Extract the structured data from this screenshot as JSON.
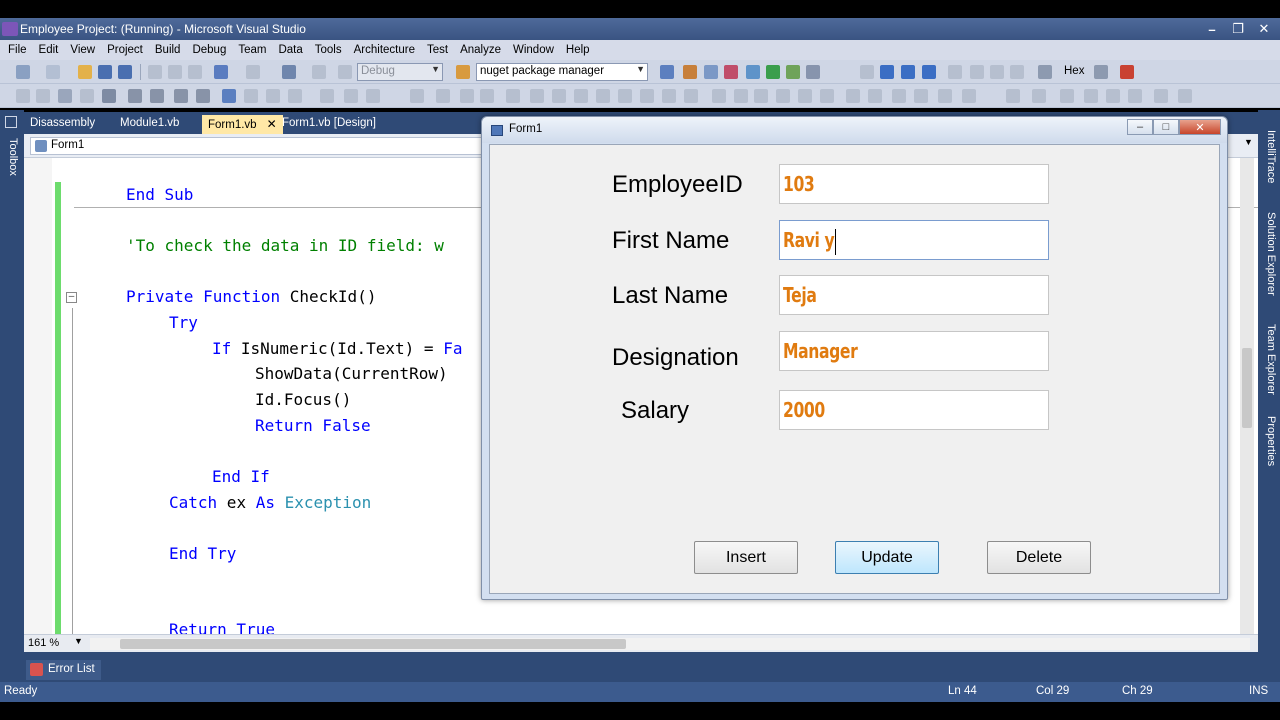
{
  "vs": {
    "title": "Employee Project: (Running) - Microsoft Visual Studio",
    "menu": [
      "File",
      "Edit",
      "View",
      "Project",
      "Build",
      "Debug",
      "Team",
      "Data",
      "Tools",
      "Architecture",
      "Test",
      "Analyze",
      "Window",
      "Help"
    ],
    "toolbar": {
      "config_combo": "Debug",
      "find_combo": "nuget package manager",
      "hex_label": "Hex"
    },
    "tabs": [
      "Disassembly",
      "Module1.vb",
      "Form1.vb",
      "Form1.vb [Design]"
    ],
    "active_tab_index": 2,
    "nav_combo": "Form1",
    "left_panel_label": "Toolbox",
    "right_panels": [
      "IntelliTrace",
      "Solution Explorer",
      "Team Explorer",
      "Properties"
    ],
    "zoom": "161 %",
    "bottom_tab": "Error List",
    "status": {
      "ready": "Ready",
      "ln": "Ln 44",
      "col": "Col 29",
      "ch": "Ch 29",
      "mode": "INS"
    }
  },
  "code": {
    "end_sub": "End Sub",
    "comment": "'To check the data in ID field: w",
    "private_kw": "Private Function",
    "func_name": " CheckId()",
    "try_kw": "Try",
    "if_kw": "If",
    "if_expr": " IsNumeric(Id.Text) = ",
    "if_tail": "Fa",
    "show_data": "ShowData(CurrentRow)",
    "focus": "Id.Focus()",
    "return_false": "Return False",
    "end_if": "End If",
    "catch_kw": "Catch",
    "catch_ex": " ex ",
    "as_kw": "As",
    "exception": " Exception",
    "end_try": "End Try",
    "return_true": "Return True"
  },
  "form": {
    "title": "Form1",
    "fields": [
      {
        "label": "EmployeeID",
        "value": "103"
      },
      {
        "label": "First Name",
        "value": "Ravi y"
      },
      {
        "label": "Last Name",
        "value": "Teja"
      },
      {
        "label": "Designation",
        "value": "Manager"
      },
      {
        "label": "Salary",
        "value": "2000"
      }
    ],
    "buttons": {
      "insert": "Insert",
      "update": "Update",
      "delete": "Delete"
    }
  },
  "colors": {
    "input_text": "#e07b10",
    "vs_chrome": "#2f4a76",
    "keyword": "#0000ff",
    "comment": "#008000",
    "type": "#2b91af"
  }
}
